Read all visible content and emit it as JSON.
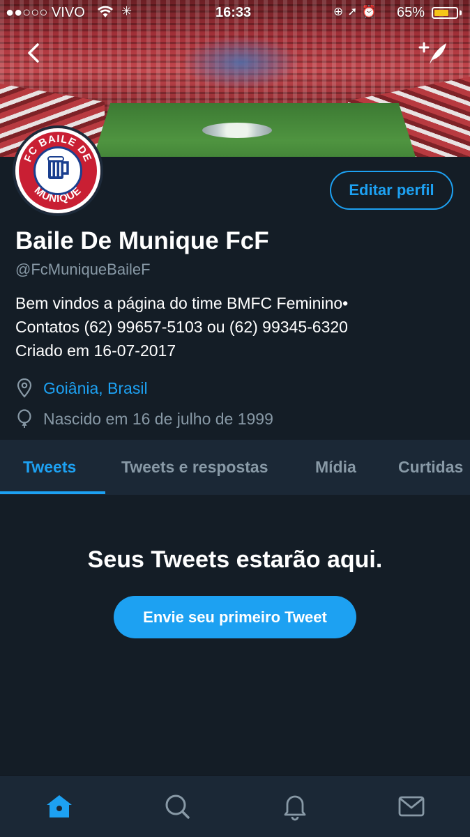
{
  "status_bar": {
    "carrier": "●●○○○ VIVO",
    "time": "16:33",
    "battery_percent": "65%",
    "battery_level": 0.65,
    "battery_color": "#f5c518"
  },
  "header": {
    "back_icon": "chevron-left-icon",
    "compose_icon": "compose-tweet-icon"
  },
  "profile": {
    "avatar_text": "FC BAILE DE MUNIQUE",
    "edit_button_label": "Editar perfil",
    "display_name": "Baile De Munique FcF",
    "handle": "@FcMuniqueBaileF",
    "bio_lines": [
      "Bem vindos a página do time BMFC Feminino•",
      "Contatos (62) 99657-5103 ou (62) 99345-6320",
      "Criado em 16-07-2017"
    ],
    "location": "Goiânia, Brasil",
    "birth": "Nascido em 16 de julho de 1999"
  },
  "tabs": [
    {
      "label": "Tweets",
      "active": true
    },
    {
      "label": "Tweets e respostas",
      "active": false
    },
    {
      "label": "Mídia",
      "active": false
    },
    {
      "label": "Curtidas",
      "active": false
    }
  ],
  "empty_state": {
    "title": "Seus Tweets estarão aqui.",
    "button_label": "Envie seu primeiro Tweet"
  },
  "bottom_nav": [
    {
      "icon": "home-icon",
      "active": true
    },
    {
      "icon": "search-icon",
      "active": false
    },
    {
      "icon": "notifications-icon",
      "active": false
    },
    {
      "icon": "messages-icon",
      "active": false
    }
  ],
  "colors": {
    "background": "#141d26",
    "panel": "#1b2836",
    "accent": "#1da1f2",
    "muted_text": "#8899a6"
  }
}
